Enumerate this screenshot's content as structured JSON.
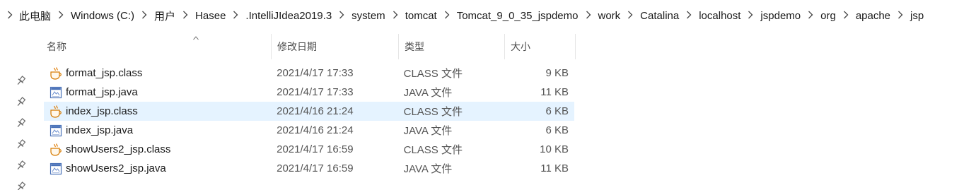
{
  "breadcrumb": [
    "此电脑",
    "Windows (C:)",
    "用户",
    "Hasee",
    ".IntelliJIdea2019.3",
    "system",
    "tomcat",
    "Tomcat_9_0_35_jspdemo",
    "work",
    "Catalina",
    "localhost",
    "jspdemo",
    "org",
    "apache",
    "jsp"
  ],
  "columns": {
    "name": "名称",
    "date": "修改日期",
    "type": "类型",
    "size": "大小"
  },
  "files": [
    {
      "name": "format_jsp.class",
      "date": "2021/4/17 17:33",
      "type": "CLASS 文件",
      "size": "9 KB",
      "icon": "java-class-icon"
    },
    {
      "name": "format_jsp.java",
      "date": "2021/4/17 17:33",
      "type": "JAVA 文件",
      "size": "11 KB",
      "icon": "java-source-icon"
    },
    {
      "name": "index_jsp.class",
      "date": "2021/4/16 21:24",
      "type": "CLASS 文件",
      "size": "6 KB",
      "icon": "java-class-icon",
      "selected": true
    },
    {
      "name": "index_jsp.java",
      "date": "2021/4/16 21:24",
      "type": "JAVA 文件",
      "size": "6 KB",
      "icon": "java-source-icon"
    },
    {
      "name": "showUsers2_jsp.class",
      "date": "2021/4/17 16:59",
      "type": "CLASS 文件",
      "size": "10 KB",
      "icon": "java-class-icon"
    },
    {
      "name": "showUsers2_jsp.java",
      "date": "2021/4/17 16:59",
      "type": "JAVA 文件",
      "size": "11 KB",
      "icon": "java-source-icon"
    }
  ],
  "colors": {
    "selected_row": "#e5f3ff",
    "header_text": "#4d4d4d"
  }
}
